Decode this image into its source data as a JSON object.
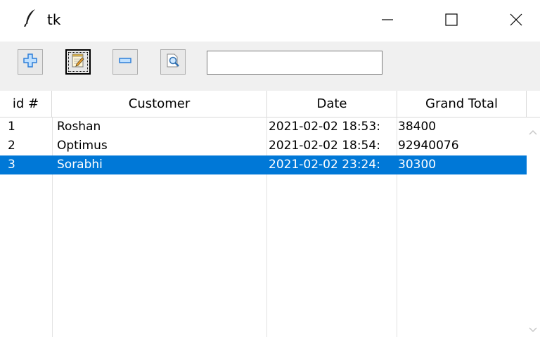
{
  "window": {
    "title": "tk",
    "icon": "tk-feather-icon",
    "controls": [
      "minimize-icon",
      "maximize-icon",
      "close-icon"
    ]
  },
  "toolbar": {
    "buttons": [
      {
        "name": "add",
        "icon": "plus-icon"
      },
      {
        "name": "edit",
        "icon": "notepad-pencil-icon",
        "focused": true
      },
      {
        "name": "remove",
        "icon": "minus-icon"
      },
      {
        "name": "search",
        "icon": "magnifier-document-icon"
      }
    ],
    "search": {
      "value": "",
      "placeholder": ""
    }
  },
  "table": {
    "columns": [
      "id #",
      "Customer",
      "Date",
      "Grand Total"
    ],
    "rows": [
      {
        "id": "1",
        "customer": "Roshan",
        "date": "2021-02-02 18:53:",
        "total": "38400",
        "selected": false
      },
      {
        "id": "2",
        "customer": "Optimus",
        "date": "2021-02-02 18:54:",
        "total": "92940076",
        "selected": false
      },
      {
        "id": "3",
        "customer": "Sorabhi",
        "date": "2021-02-02 23:24:",
        "total": "30300",
        "selected": true
      }
    ]
  },
  "colors": {
    "selection": "#0078d7",
    "toolbar_bg": "#f0f0f0",
    "icon_blue": "#3b8ee6"
  }
}
